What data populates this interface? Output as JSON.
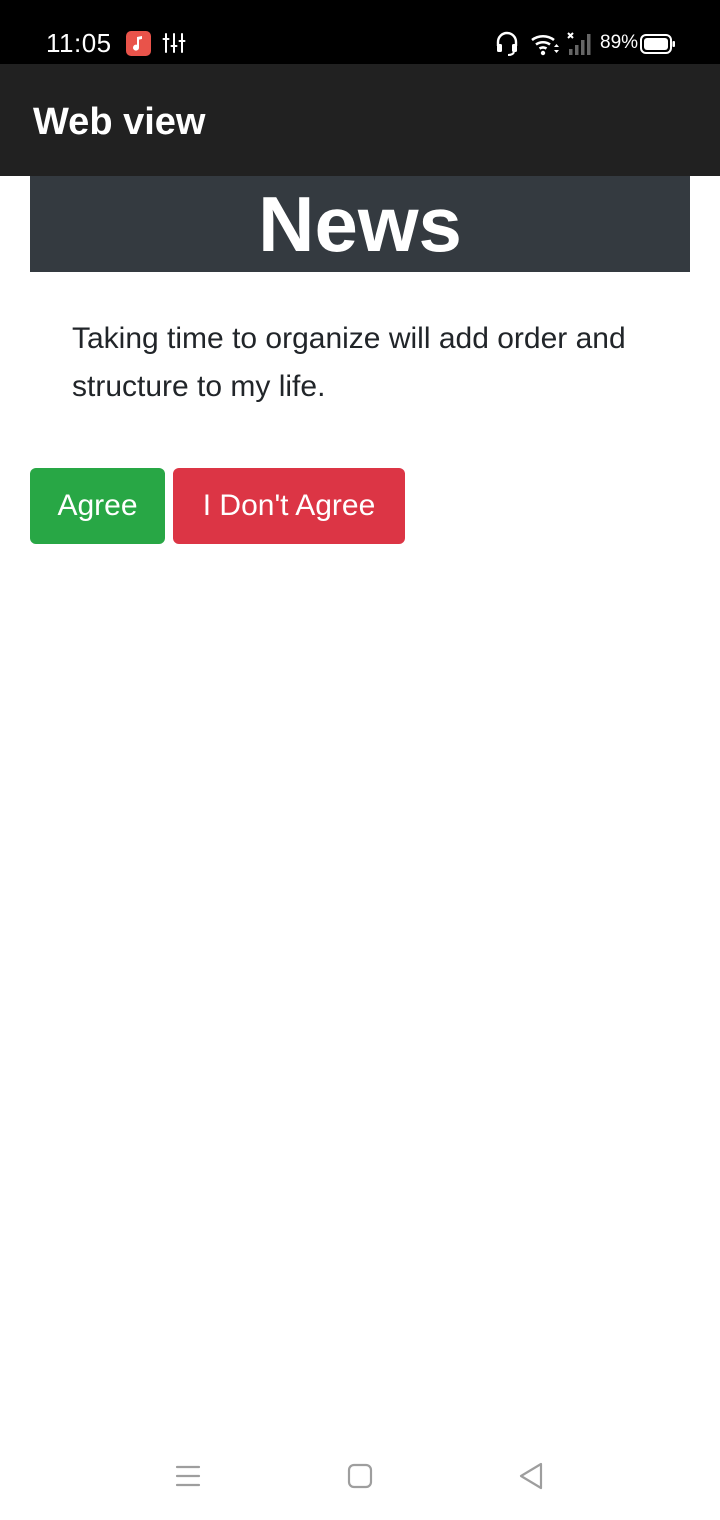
{
  "status_bar": {
    "time": "11:05",
    "battery": "89%",
    "icons": [
      "music-app-icon",
      "equalizer-icon",
      "headset-icon",
      "wifi-icon",
      "signal-icon",
      "battery-icon"
    ]
  },
  "app_bar": {
    "title": "Web view"
  },
  "main": {
    "header_title": "News",
    "quote": "Taking time to organize will add order and structure to my life.",
    "agree_label": "Agree",
    "disagree_label": "I Don't Agree"
  },
  "nav_bar": {
    "icons": [
      "menu-icon",
      "home-icon",
      "back-icon"
    ]
  },
  "colors": {
    "status_bar": "#000000",
    "app_bar": "#212121",
    "header_bg": "#343a40",
    "agree": "#28a745",
    "disagree": "#dc3545",
    "music_icon": "#e9534a"
  }
}
